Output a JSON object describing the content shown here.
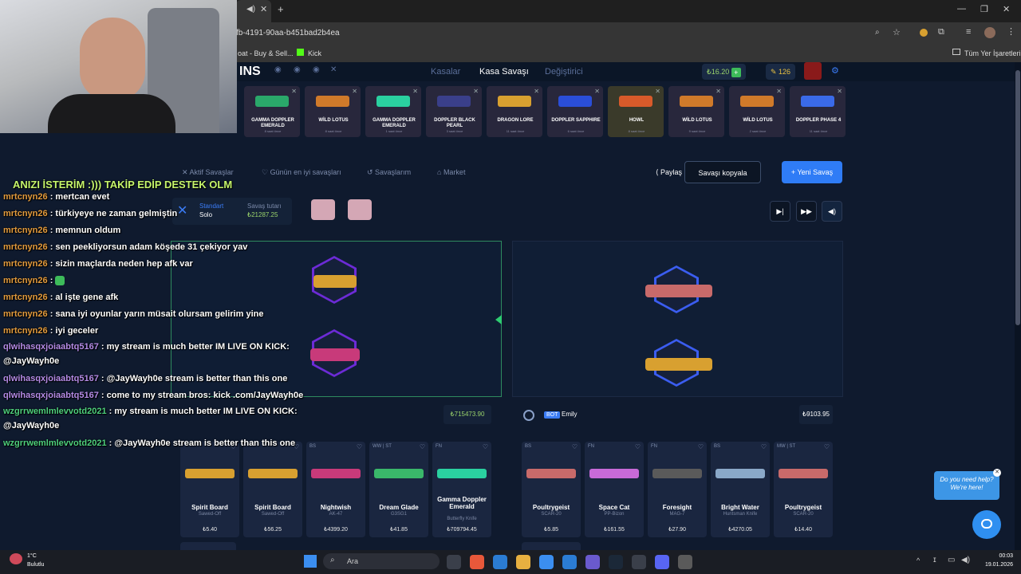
{
  "browser": {
    "url": "fb-4191-90aa-b451bad2b4ea",
    "bookmarks": [
      "oat - Buy & Sell...",
      "Kick"
    ],
    "all_bookmarks": "Tüm Yer İşaretleri"
  },
  "site": {
    "logo": "INS",
    "nav": [
      "Kasalar",
      "Kasa Savaşı",
      "Değiştirici"
    ],
    "balance": "₺16.20",
    "level": "126"
  },
  "drops": [
    {
      "name": "GAMMA DOPPLER EMERALD",
      "sub": "8 saat önce",
      "color": "#2aa86a"
    },
    {
      "name": "WİLD LOTUS",
      "sub": "8 saat önce",
      "color": "#d07a2a"
    },
    {
      "name": "GAMMA DOPPLER EMERALD",
      "sub": "1 saat önce",
      "color": "#2ad0a0"
    },
    {
      "name": "DOPPLER BLACK PEARL",
      "sub": "3 saat önce",
      "color": "#3a3f8a"
    },
    {
      "name": "DRAGON LORE",
      "sub": "11 saat önce",
      "color": "#d8a030"
    },
    {
      "name": "DOPPLER SAPPHIRE",
      "sub": "6 saat önce",
      "color": "#2a4ed8"
    },
    {
      "name": "HOWL",
      "sub": "8 saat önce",
      "color": "#d85a2a"
    },
    {
      "name": "WİLD LOTUS",
      "sub": "9 saat önce",
      "color": "#d07a2a"
    },
    {
      "name": "WİLD LOTUS",
      "sub": "2 saat önce",
      "color": "#d07a2a"
    },
    {
      "name": "DOPPLER PHASE 4",
      "sub": "11 saat önce",
      "color": "#3a6ae8"
    }
  ],
  "toolbar": {
    "tabs": [
      "Aktif Savaşlar",
      "Günün en iyi savaşları",
      "Savaşlarım",
      "Market"
    ],
    "share": "Paylaş",
    "copy": "Savaşı kopyala",
    "new": "+ Yeni Savaş"
  },
  "mode": {
    "label": "Standart",
    "sub": "Solo",
    "total_label": "Savaş tutarı",
    "total": "₺21287.25"
  },
  "player1": {
    "total": "₺715473.90"
  },
  "player2": {
    "bot": "BOT",
    "name": "Emily",
    "total": "₺9103.95"
  },
  "items_left": [
    {
      "q": "",
      "name": "Spirit Board",
      "sub": "Sawed-Off",
      "price": "₺5.40",
      "color": "#d8a030"
    },
    {
      "q": "",
      "name": "Spirit Board",
      "sub": "Sawed-Off",
      "price": "₺56.25",
      "color": "#d8a030"
    },
    {
      "q": "BS",
      "name": "Nightwish",
      "sub": "AK-47",
      "price": "₺4399.20",
      "color": "#c83a7a"
    },
    {
      "q": "WW | ST",
      "name": "Dream Glade",
      "sub": "G3SG1",
      "price": "₺41.85",
      "color": "#3ab86a"
    },
    {
      "q": "FN",
      "name": "Gamma Doppler Emerald",
      "sub": "Butterfly Knife",
      "price": "₺709794.45",
      "color": "#2ad0a0"
    }
  ],
  "items_right": [
    {
      "q": "BS",
      "name": "Poultrygeist",
      "sub": "SCAR-20",
      "price": "₺5.85",
      "color": "#c86a6a"
    },
    {
      "q": "FN",
      "name": "Space Cat",
      "sub": "PP-Bizon",
      "price": "₺161.55",
      "color": "#c86ad8"
    },
    {
      "q": "FN",
      "name": "Foresight",
      "sub": "MAG-7",
      "price": "₺27.90",
      "color": "#5a5a5a"
    },
    {
      "q": "BS",
      "name": "Bright Water",
      "sub": "Huntsman Knife",
      "price": "₺4270.05",
      "color": "#8aa8c8"
    },
    {
      "q": "MW | ST",
      "name": "Poultrygeist",
      "sub": "SCAR-20",
      "price": "₺14.40",
      "color": "#c86a6a"
    }
  ],
  "banner": "ANIZI İSTERİM :))) TAKİP EDİP DESTEK OLM",
  "chat": [
    {
      "user": "mrtcnyn26",
      "msg": "mertcan evet",
      "cls": "cname"
    },
    {
      "user": "mrtcnyn26",
      "msg": "türkiyeye ne zaman gelmiştin",
      "cls": "cname"
    },
    {
      "user": "mrtcnyn26",
      "msg": "memnun oldum",
      "cls": "cname"
    },
    {
      "user": "mrtcnyn26",
      "msg": "sen peekliyorsun adam köşede 31 çekiyor yav",
      "cls": "cname"
    },
    {
      "user": "mrtcnyn26",
      "msg": "sizin maçlarda neden hep afk var",
      "cls": "cname"
    },
    {
      "user": "mrtcnyn26",
      "msg": "",
      "cls": "cname"
    },
    {
      "user": "mrtcnyn26",
      "msg": "al işte gene afk",
      "cls": "cname"
    },
    {
      "user": "mrtcnyn26",
      "msg": "sana iyi oyunlar yarın müsait olursam gelirim yine",
      "cls": "cname"
    },
    {
      "user": "mrtcnyn26",
      "msg": "iyi geceler",
      "cls": "cname"
    },
    {
      "user": "qlwihasqxjoiaabtq5167",
      "msg": "my stream is much better IM LIVE ON KICK: @JayWayh0e",
      "cls": "cname2"
    },
    {
      "user": "qlwihasqxjoiaabtq5167",
      "msg": "@JayWayh0e stream is better than this one",
      "cls": "cname2"
    },
    {
      "user": "qlwihasqxjoiaabtq5167",
      "msg": "come to my stream bros: kick .com/JayWayh0e",
      "cls": "cname2"
    },
    {
      "user": "wzgrrwemlmlevvotd2021",
      "msg": "my stream is much better IM LIVE ON KICK: @JayWayh0e",
      "cls": "cname3"
    },
    {
      "user": "wzgrrwemlmlevvotd2021",
      "msg": "@JayWayh0e stream is better than this one",
      "cls": "cname3"
    }
  ],
  "help": {
    "line1": "Do you need help?",
    "line2": "We're here!"
  },
  "taskbar": {
    "weather_temp": "1°C",
    "weather_text": "Bulutlu",
    "search": "Ara",
    "time": "00:03",
    "date": "19.01.2026"
  }
}
